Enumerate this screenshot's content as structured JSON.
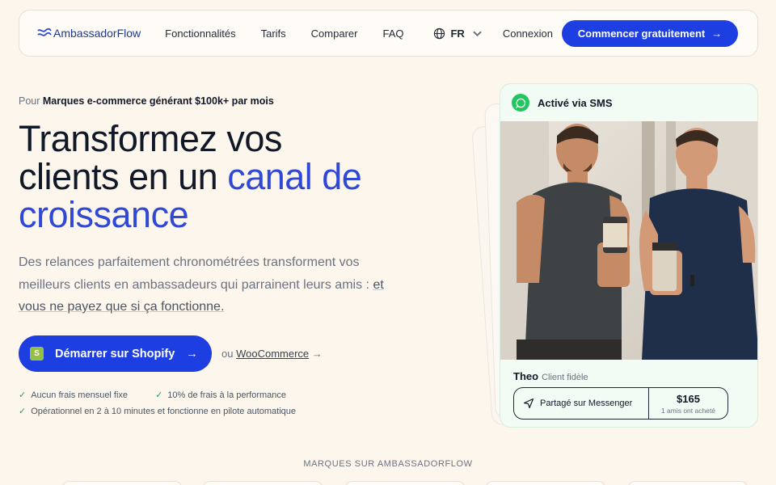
{
  "nav": {
    "logo": "AmbassadorFlow",
    "links": [
      "Fonctionnalités",
      "Tarifs",
      "Comparer",
      "FAQ"
    ],
    "lang": "FR",
    "login": "Connexion",
    "cta": "Commencer gratuitement"
  },
  "hero": {
    "audience_prefix": "Pour",
    "audience_bold": "Marques e-commerce générant $100k+ par mois",
    "headline_1": "Transformez vos",
    "headline_2": "clients en un",
    "headline_accent_1": "canal de",
    "headline_accent_2": "croissance",
    "subtext": "Des relances parfaitement chronométrées transforment vos meilleurs clients en ambassadeurs qui parrainent leurs amis :",
    "subtext_link": "et vous ne payez que si ça fonctionne.",
    "cta": "Démarrer sur Shopify",
    "alt_prefix": "ou",
    "alt_link": "WooCommerce",
    "checks": [
      "Aucun frais mensuel fixe",
      "10% de frais à la performance",
      "Opérationnel en 2 à 10 minutes et fonctionne en pilote automatique"
    ]
  },
  "card": {
    "channel": "Activé via SMS",
    "name": "Theo",
    "role": "Client fidèle",
    "share_label": "Partagé sur Messenger",
    "amount": "$165",
    "amount_sub": "1 amis ont acheté"
  },
  "brands": {
    "heading": "MARQUES SUR AMBASSADORFLOW"
  },
  "colors": {
    "accent": "#1d3ee0",
    "background": "#fdf6ec",
    "card_bg": "#f2fbf4",
    "success": "#22c55e"
  }
}
